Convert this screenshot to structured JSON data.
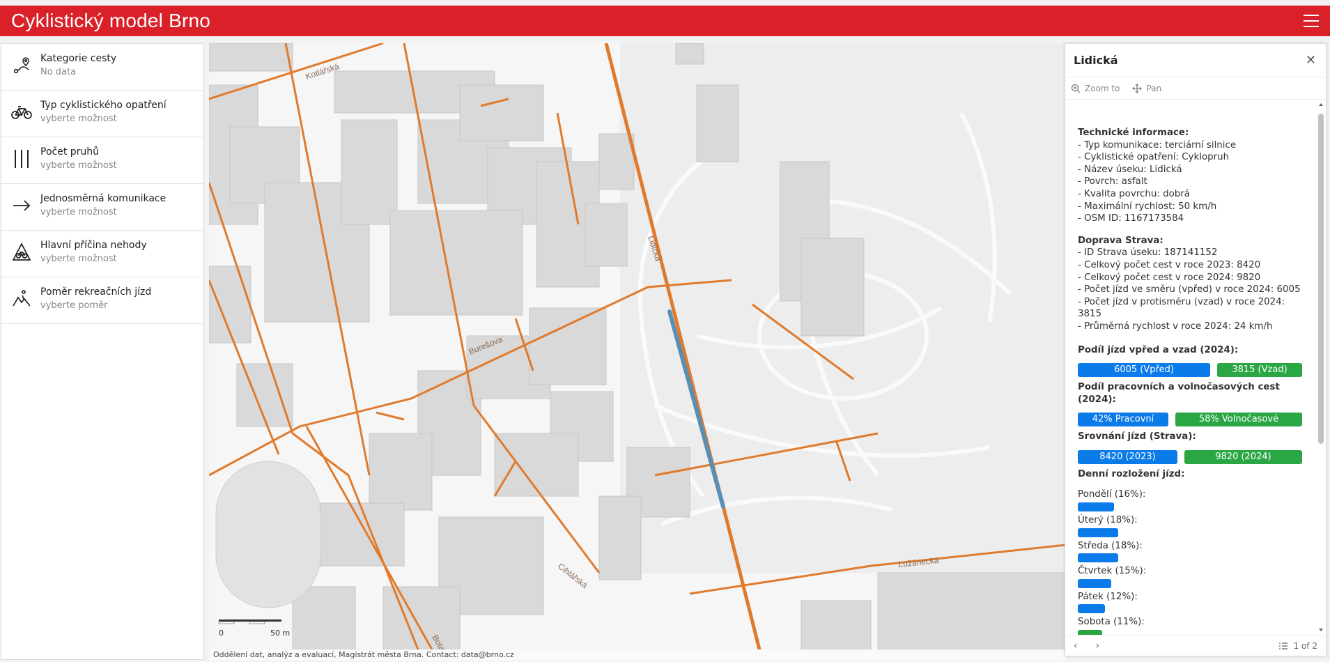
{
  "header": {
    "title": "Cyklistický model Brno"
  },
  "sidebar": {
    "items": [
      {
        "label": "Kategorie cesty",
        "sub": "No data"
      },
      {
        "label": "Typ cyklistického opatření",
        "sub": "vyberte možnost"
      },
      {
        "label": "Počet pruhů",
        "sub": "vyberte možnost"
      },
      {
        "label": "Jednosměrná komunikace",
        "sub": "vyberte možnost"
      },
      {
        "label": "Hlavní příčina nehody",
        "sub": "vyberte možnost"
      },
      {
        "label": "Poměr rekreačních jízd",
        "sub": "vyberte poměr"
      }
    ]
  },
  "map": {
    "streets": [
      "Kotlářská",
      "Lidická",
      "Burešova",
      "Cihlářská",
      "Lužánecká",
      "Botanická"
    ],
    "scale": {
      "zero": "0",
      "end": "50 m"
    },
    "attribution": "Oddělení dat, analýz a evaluací, Magistrát města Brna. Contact: data@brno.cz",
    "colors": {
      "road": "#e07a2c",
      "selected": "#5a8fb5",
      "building": "#d9d9d9",
      "park": "#e6e6e6"
    }
  },
  "popup": {
    "title": "Lidická",
    "zoom_label": "Zoom to",
    "pan_label": "Pan",
    "tech_title": "Technické informace:",
    "tech_lines": [
      "- Typ komunikace: terciární silnice",
      "- Cyklistické opatření: Cyklopruh",
      "- Název úseku: Lidická",
      "- Povrch: asfalt",
      "- Kvalita povrchu: dobrá",
      "- Maximální rychlost: 50 km/h",
      "- OSM ID: 1167173584"
    ],
    "strava_title": "Doprava Strava:",
    "strava_lines": [
      "- ID Strava úseku: 187141152",
      "- Celkový počet cest v roce 2023: 8420",
      "- Celkový počet cest v roce 2024: 9820",
      "- Počet jízd ve směru (vpřed) v roce 2024: 6005",
      "- Počet jízd v protisměru (vzad) v roce 2024: 3815",
      "- Průměrná rychlost v roce 2024: 24 km/h"
    ],
    "direction_title": "Podíl jízd vpřed a vzad (2024):",
    "direction_bars": [
      {
        "label": "6005 (Vpřed)",
        "value": 6005,
        "color": "#0b7bea"
      },
      {
        "label": "3815 (Vzad)",
        "value": 3815,
        "color": "#2aa744"
      }
    ],
    "purpose_title": "Podíl pracovních a volnočasových cest (2024):",
    "purpose_bars": [
      {
        "label": "42% Pracovní",
        "value": 42,
        "color": "#0b7bea"
      },
      {
        "label": "58% Volnočasové",
        "value": 58,
        "color": "#2aa744"
      }
    ],
    "compare_title": "Srovnání jízd (Strava):",
    "compare_bars": [
      {
        "label": "8420 (2023)",
        "value": 8420,
        "color": "#0b7bea"
      },
      {
        "label": "9820 (2024)",
        "value": 9820,
        "color": "#2aa744"
      }
    ],
    "daily_title": "Denní rozložení jízd:",
    "daily": [
      {
        "label": "Pondělí (16%):",
        "value": 16,
        "color": "#0b7bea"
      },
      {
        "label": "Úterý (18%):",
        "value": 18,
        "color": "#0b7bea"
      },
      {
        "label": "Středa (18%):",
        "value": 18,
        "color": "#0b7bea"
      },
      {
        "label": "Čtvrtek (15%):",
        "value": 15,
        "color": "#0b7bea"
      },
      {
        "label": "Pátek (12%):",
        "value": 12,
        "color": "#0b7bea"
      },
      {
        "label": "Sobota (11%):",
        "value": 11,
        "color": "#2aa744"
      }
    ],
    "pager": "1 of 2"
  }
}
